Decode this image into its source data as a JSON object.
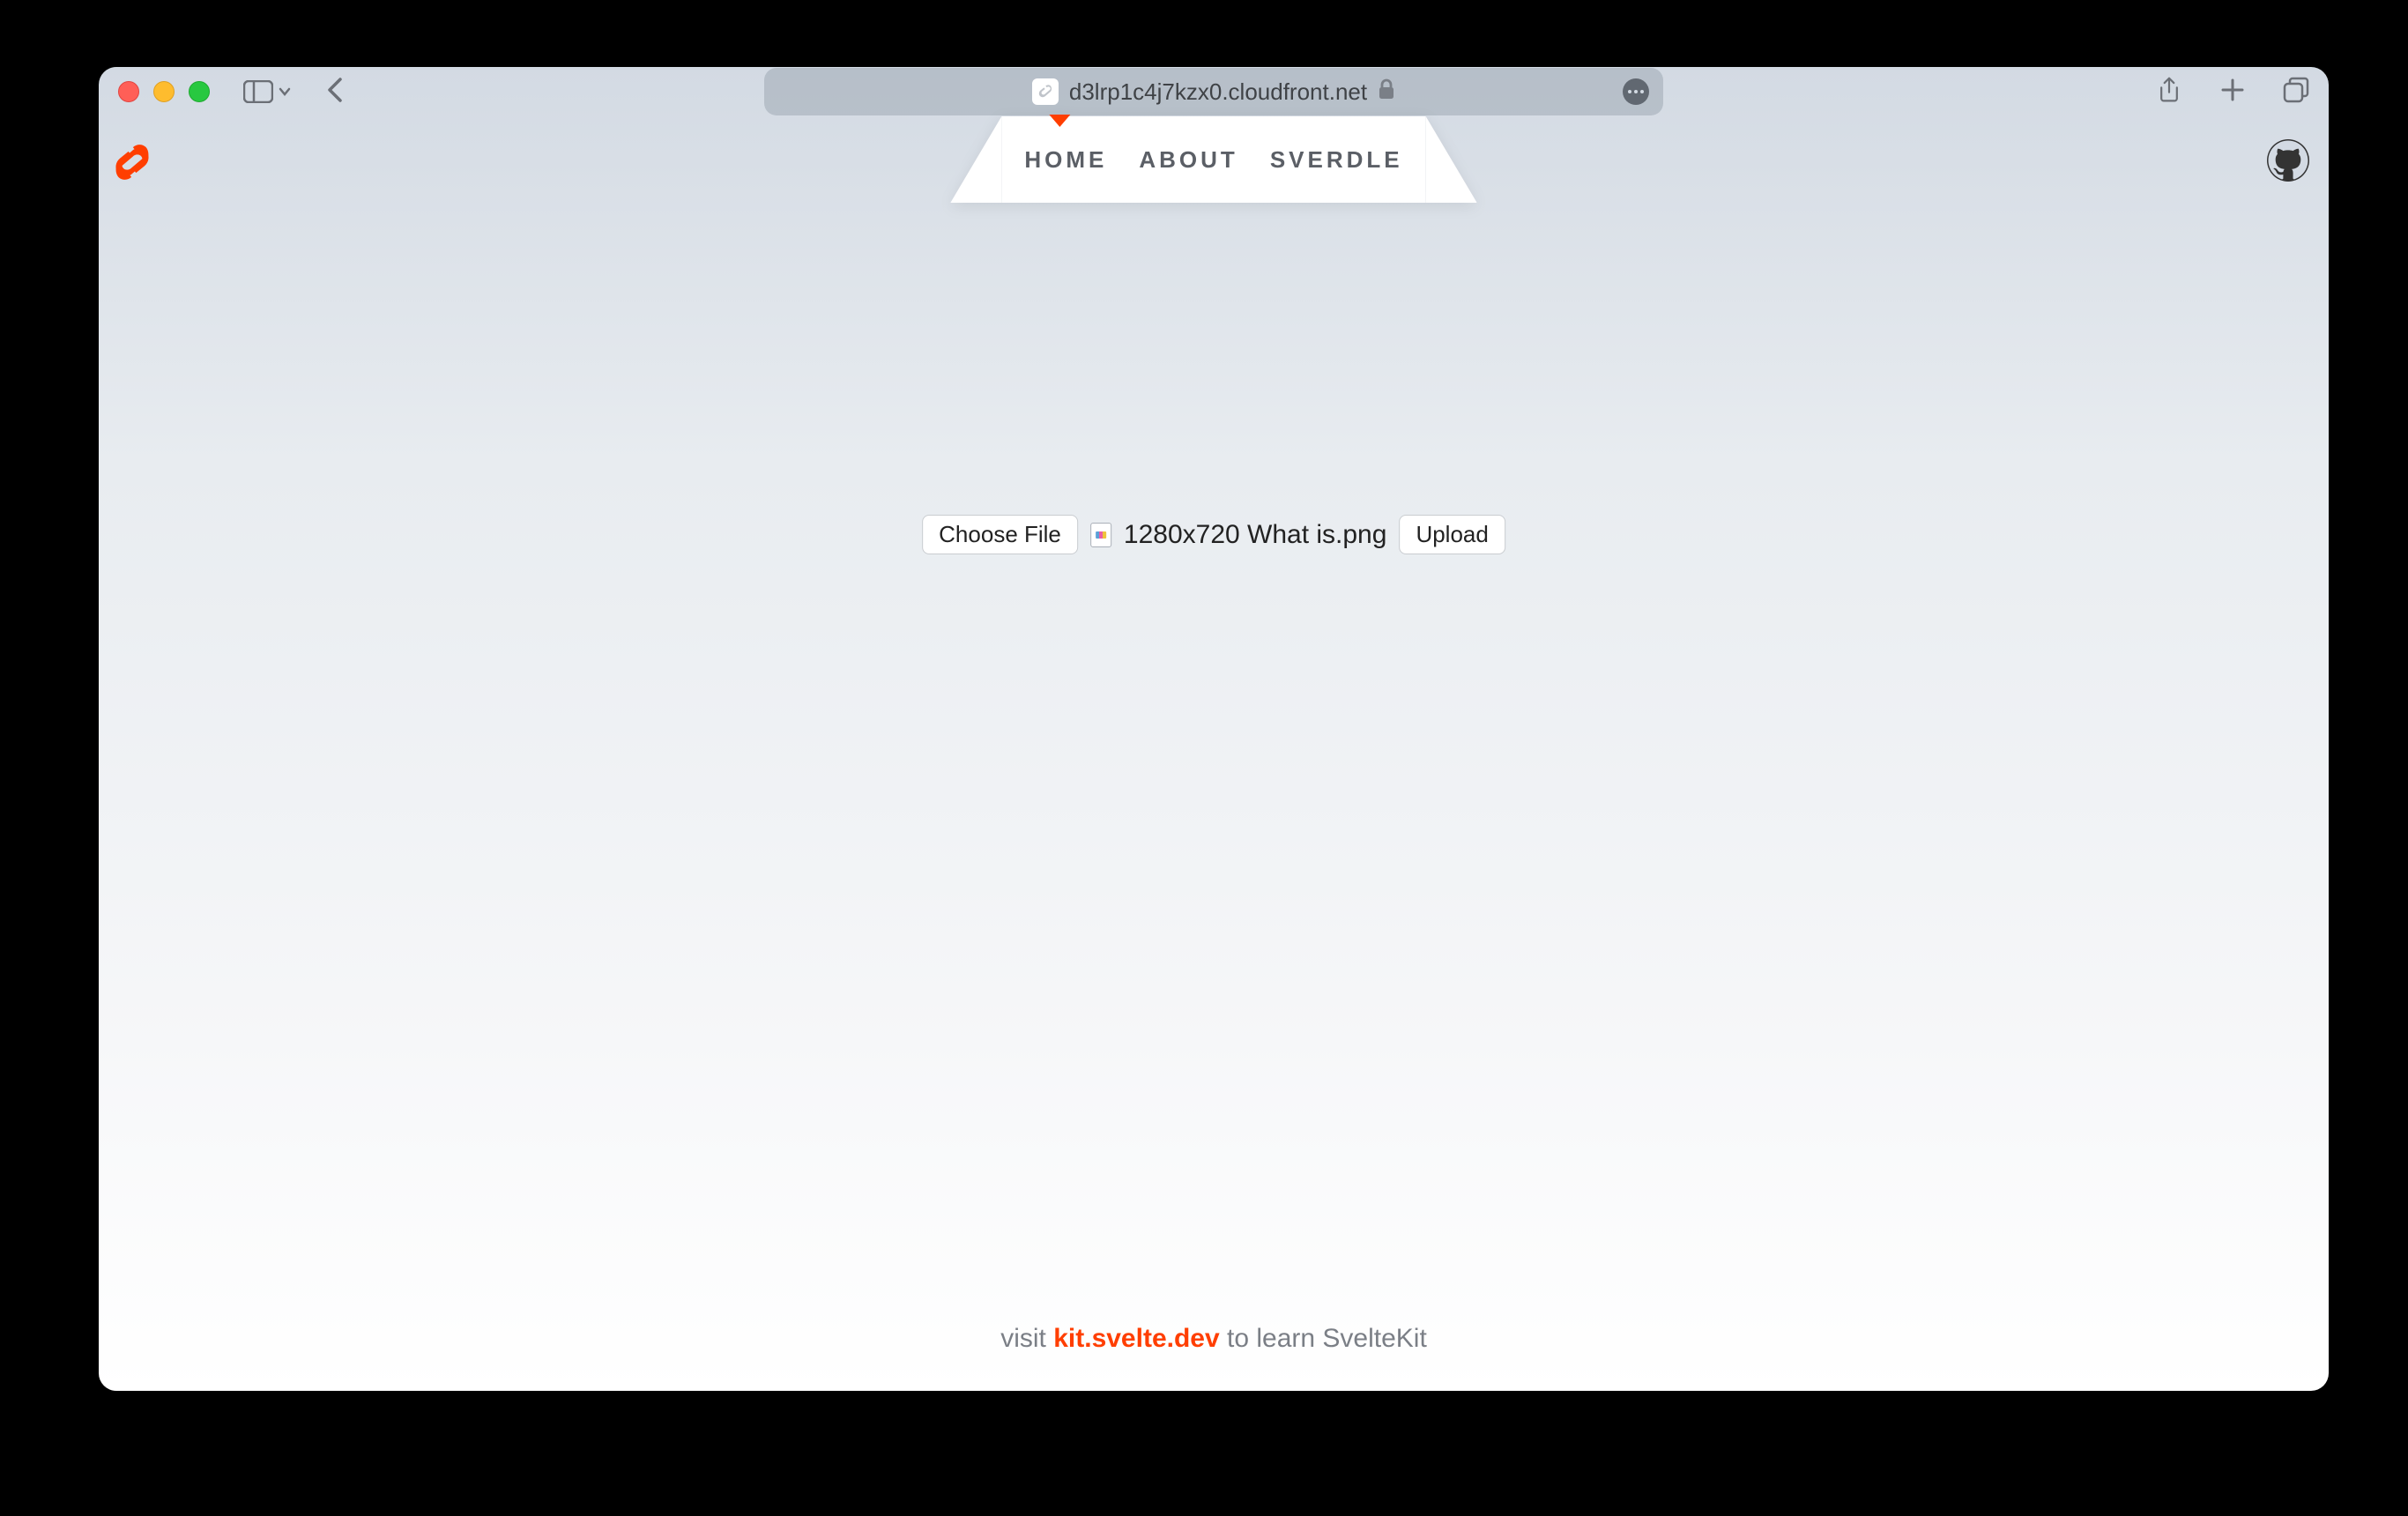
{
  "browser": {
    "url": "d3lrp1c4j7kzx0.cloudfront.net"
  },
  "nav": {
    "items": [
      {
        "label": "HOME"
      },
      {
        "label": "ABOUT"
      },
      {
        "label": "SVERDLE"
      }
    ],
    "active_index": 0
  },
  "upload": {
    "choose_label": "Choose File",
    "filename": "1280x720 What is.png",
    "upload_label": "Upload"
  },
  "footer": {
    "prefix": "visit ",
    "link_text": "kit.svelte.dev",
    "suffix": " to learn SvelteKit"
  }
}
